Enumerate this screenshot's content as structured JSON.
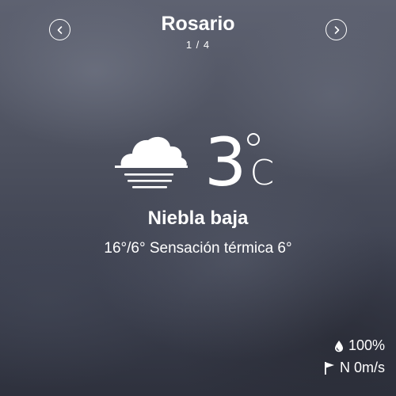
{
  "header": {
    "city": "Rosario",
    "page_indicator": "1 / 4",
    "prev_icon": "chevron-left-icon",
    "next_icon": "chevron-right-icon"
  },
  "current": {
    "icon": "fog-icon",
    "temperature": "3",
    "unit": "C",
    "condition": "Niebla baja",
    "details": "16°/6° Sensación térmica 6°"
  },
  "stats": {
    "humidity": {
      "icon": "water-drop-icon",
      "value": "100%"
    },
    "wind": {
      "icon": "flag-icon",
      "value": "N 0m/s"
    }
  },
  "colors": {
    "text": "#ffffff",
    "background_top": "#5e6271",
    "background_bottom": "#2e313d"
  }
}
